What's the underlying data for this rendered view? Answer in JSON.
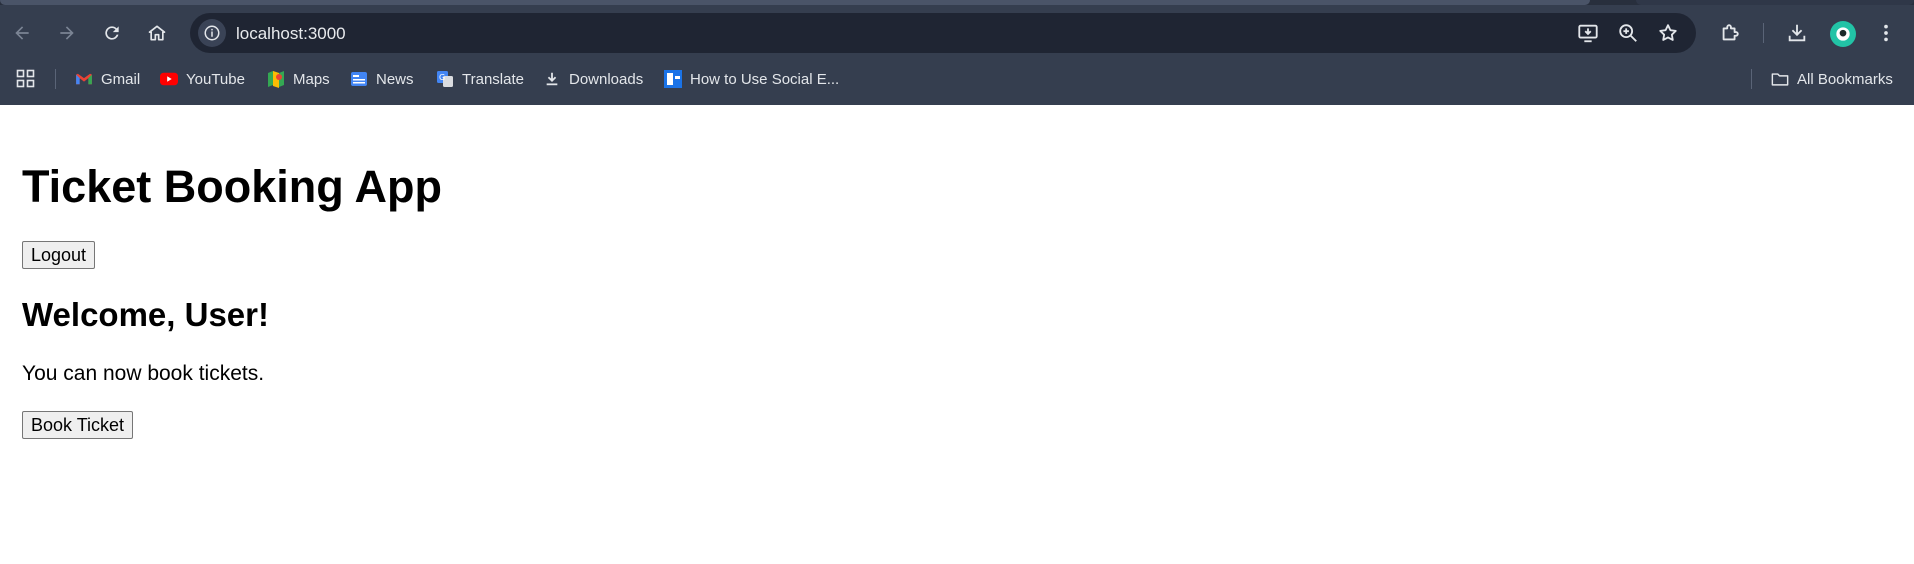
{
  "browser": {
    "url": "localhost:3000",
    "bookmarks": [
      {
        "label": "Gmail",
        "icon": "gmail-icon"
      },
      {
        "label": "YouTube",
        "icon": "youtube-icon"
      },
      {
        "label": "Maps",
        "icon": "maps-icon"
      },
      {
        "label": "News",
        "icon": "news-icon"
      },
      {
        "label": "Translate",
        "icon": "translate-icon"
      },
      {
        "label": "Downloads",
        "icon": "download-icon"
      },
      {
        "label": "How to Use Social E...",
        "icon": "page-favicon-icon"
      }
    ],
    "all_bookmarks_label": "All Bookmarks",
    "colors": {
      "chrome_bg": "#353e4f",
      "omnibox_bg": "#1f2533",
      "avatar": "#22c3a6"
    }
  },
  "app": {
    "title": "Ticket Booking App",
    "logout_label": "Logout",
    "welcome": "Welcome, User!",
    "message": "You can now book tickets.",
    "book_label": "Book Ticket"
  }
}
